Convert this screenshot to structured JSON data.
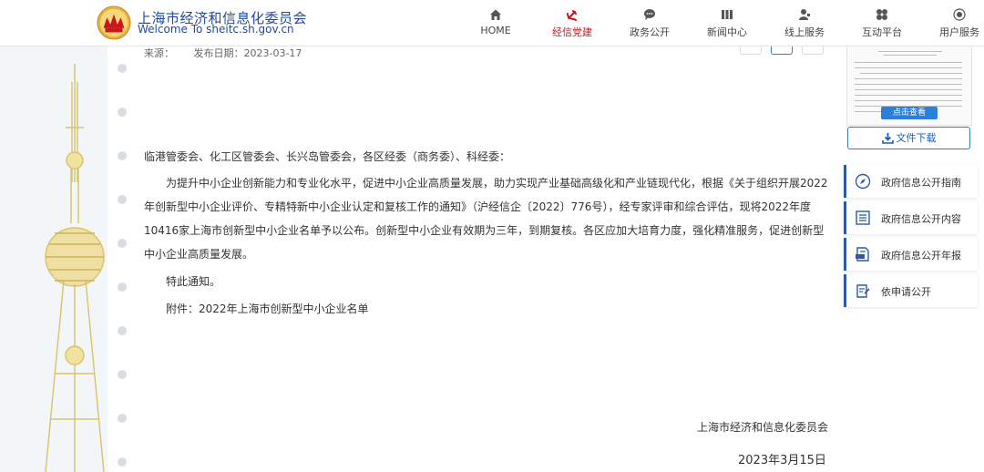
{
  "header": {
    "site_name_cn": "上海市经济和信息化委员会",
    "site_name_en": "Welcome To sheitc.sh.gov.cn",
    "nav": [
      {
        "label": "HOME",
        "icon": "home-icon"
      },
      {
        "label": "经信党建",
        "icon": "party-emblem-icon",
        "active": true
      },
      {
        "label": "政务公开",
        "icon": "chat-bubble-icon"
      },
      {
        "label": "新闻中心",
        "icon": "newspaper-icon"
      },
      {
        "label": "线上服务",
        "icon": "user-service-icon"
      },
      {
        "label": "互动平台",
        "icon": "interaction-icon"
      },
      {
        "label": "用户服务",
        "icon": "user-center-icon"
      }
    ]
  },
  "article": {
    "source_label": "来源：",
    "publish_date_label": "发布日期：2023-03-17",
    "greeting": "临港管委会、化工区管委会、长兴岛管委会，各区经委（商务委）、科经委：",
    "body": "为提升中小企业创新能力和专业化水平，促进中小企业高质量发展，助力实现产业基础高级化和产业链现代化，根据《关于组织开展2022年创新型中小企业评价、专精特新中小企业认定和复核工作的通知》（沪经信企〔2022〕776号），经专家评审和综合评估，现将2022年度10416家上海市创新型中小企业名单予以公布。创新型中小企业有效期为三年，到期复核。各区应加大培育力度，强化精准服务，促进创新型中小企业高质量发展。",
    "notice": "特此通知。",
    "attachment": "附件：2022年上海市创新型中小企业名单",
    "signature": "上海市经济和信息化委员会",
    "date": "2023年3月15日"
  },
  "sidebar": {
    "view_button": "点击查看",
    "download_button": "文件下载",
    "links": [
      {
        "label": "政府信息公开指南",
        "icon": "compass-icon"
      },
      {
        "label": "政府信息公开内容",
        "icon": "list-icon"
      },
      {
        "label": "政府信息公开年报",
        "icon": "report-icon"
      },
      {
        "label": "依申请公开",
        "icon": "application-form-icon"
      }
    ]
  },
  "colors": {
    "brand_blue": "#1f4aa0",
    "nav_active_red": "#c8161d",
    "button_blue": "#2b7fd6"
  }
}
